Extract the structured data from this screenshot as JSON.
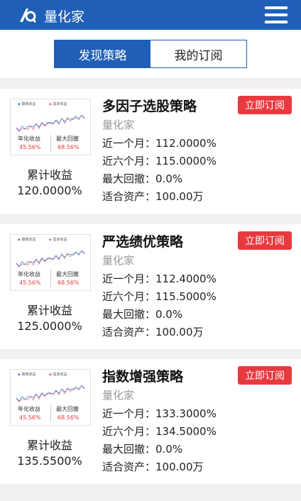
{
  "header": {
    "app_name": "量化家",
    "logo_icon": "quant-logo-icon",
    "menu_icon": "hamburger-icon"
  },
  "tabs": [
    {
      "label": "发现策略",
      "active": true
    },
    {
      "label": "我的订阅",
      "active": false
    }
  ],
  "colors": {
    "brand": "#1f5fb8",
    "accent": "#e8393f",
    "series_blue": "#3c8ae6",
    "series_red": "#e87070"
  },
  "thumbnail": {
    "legend_a": "策略收益",
    "legend_b": "基准收益",
    "kpi_annual_label": "年化收益",
    "kpi_annual_value": "45.56%",
    "kpi_drawdown_label": "最大回撤",
    "kpi_drawdown_value": "68.56%"
  },
  "strategies": [
    {
      "name": "多因子选股策略",
      "provider": "量化家",
      "month_1": "近一个月：112.0000%",
      "month_6": "近六个月：115.0000%",
      "max_drawdown": "最大回撤：0.0%",
      "suitable_assets": "适合资产：100.00万",
      "cum_label": "累计收益",
      "cum_value": "120.0000%",
      "subscribe_label": "立即订阅"
    },
    {
      "name": "严选绩优策略",
      "provider": "量化家",
      "month_1": "近一个月：112.4000%",
      "month_6": "近六个月：115.5000%",
      "max_drawdown": "最大回撤：0.0%",
      "suitable_assets": "适合资产：100.00万",
      "cum_label": "累计收益",
      "cum_value": "125.0000%",
      "subscribe_label": "立即订阅"
    },
    {
      "name": "指数增强策略",
      "provider": "量化家",
      "month_1": "近一个月：133.3000%",
      "month_6": "近六个月：134.5000%",
      "max_drawdown": "最大回撤：0.0%",
      "suitable_assets": "适合资产：100.00万",
      "cum_label": "累计收益",
      "cum_value": "135.5500%",
      "subscribe_label": "立即订阅"
    }
  ]
}
